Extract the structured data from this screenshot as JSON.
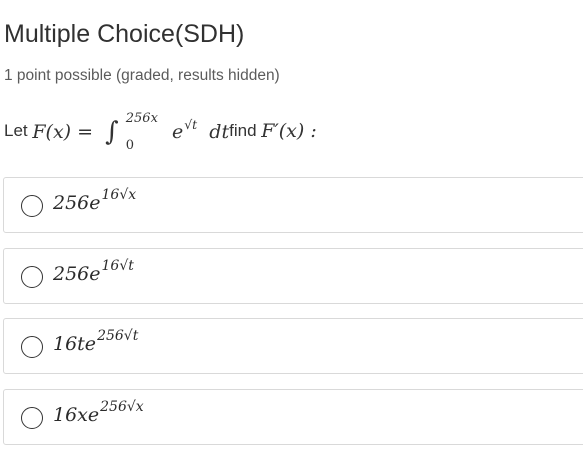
{
  "problem": {
    "title": "Multiple Choice(SDH)",
    "points": "1 point possible (graded, results hidden)",
    "prompt_prefix": "Let",
    "function_lhs": "F(x) =",
    "integral_sign": "∫",
    "upper_limit": "256x",
    "lower_limit": "0",
    "integrand_base": "e",
    "integrand_exponent": "√t",
    "differential": "dt",
    "prompt_middle": "find",
    "derivative": "F′(x) :",
    "options": [
      {
        "coefficient": "256e",
        "exponent": "16√x",
        "selected": false
      },
      {
        "coefficient": "256e",
        "exponent": "16√t",
        "selected": false
      },
      {
        "coefficient": "16te",
        "exponent": "256√t",
        "selected": false
      },
      {
        "coefficient": "16xe",
        "exponent": "256√x",
        "selected": false
      }
    ]
  }
}
